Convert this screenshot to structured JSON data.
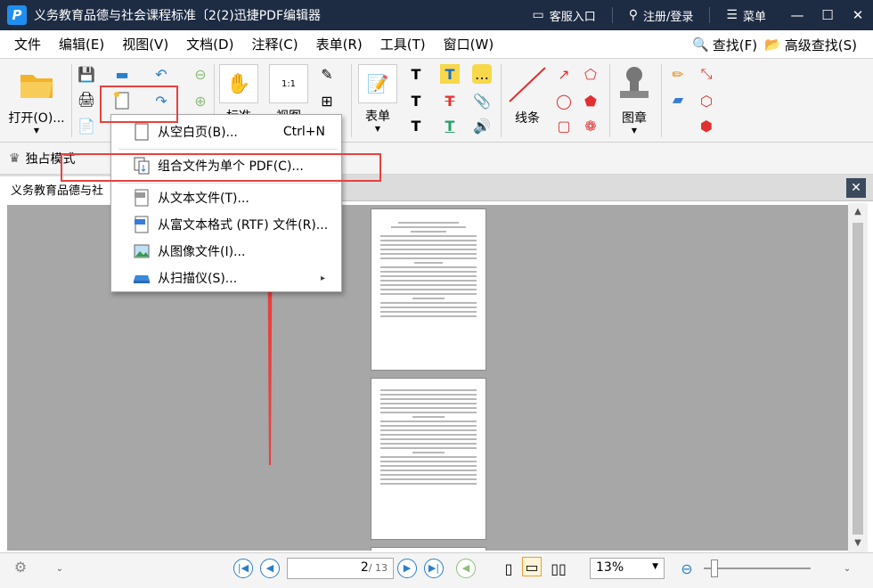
{
  "titlebar": {
    "logo": "P",
    "title": "义务教育品德与社会课程标准〔2(2)迅捷PDF编辑器",
    "links": [
      {
        "icon": "monitor-icon",
        "label": "客服入口"
      },
      {
        "icon": "user-icon",
        "label": "注册/登录"
      },
      {
        "icon": "menu-icon",
        "label": "菜单"
      }
    ]
  },
  "menubar": {
    "items": [
      "文件",
      "编辑(E)",
      "视图(V)",
      "文档(D)",
      "注释(C)",
      "表单(R)",
      "工具(T)",
      "窗口(W)"
    ],
    "find": "查找(F)",
    "advanced_find": "高级查找(S)"
  },
  "ribbon": {
    "open": "打开(O)...",
    "form": "表单",
    "lines": "线条",
    "stamp": "图章",
    "hand": "标准",
    "view": "视图"
  },
  "modebar": {
    "exclusive_mode": "独占模式"
  },
  "tabs": {
    "doc_tab": "义务教育品德与社"
  },
  "dropdown": {
    "items": [
      {
        "icon": "blank-page-icon",
        "label": "从空白页(B)...",
        "shortcut": "Ctrl+N"
      },
      {
        "icon": "combine-files-icon",
        "label": "组合文件为单个 PDF(C)...",
        "shortcut": ""
      },
      {
        "icon": "txt-file-icon",
        "label": "从文本文件(T)...",
        "shortcut": ""
      },
      {
        "icon": "rtf-file-icon",
        "label": "从富文本格式 (RTF) 文件(R)...",
        "shortcut": ""
      },
      {
        "icon": "image-file-icon",
        "label": "从图像文件(I)...",
        "shortcut": ""
      },
      {
        "icon": "scanner-icon",
        "label": "从扫描仪(S)...",
        "shortcut": "▸"
      }
    ]
  },
  "statusbar": {
    "page_current": "2",
    "page_total": "/ 13",
    "zoom": "13%"
  },
  "colors": {
    "titlebar": "#1d2b43",
    "highlight": "#e8413e",
    "accent": "#2a80c8"
  }
}
